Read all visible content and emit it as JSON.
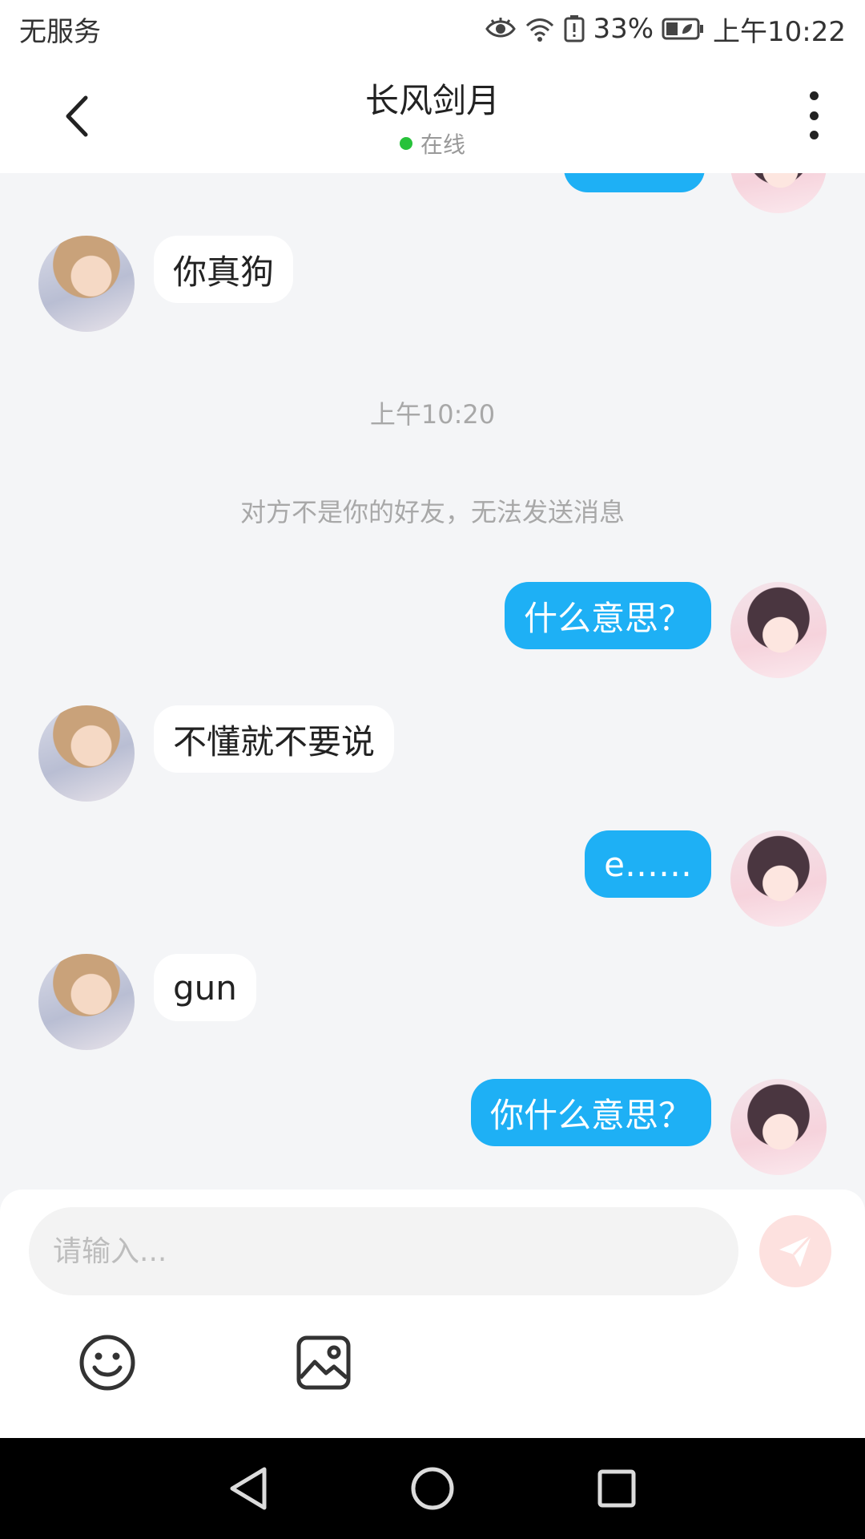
{
  "status_bar": {
    "carrier": "无服务",
    "battery_percent": "33%",
    "time": "上午10:22",
    "icons": [
      "eye-icon",
      "wifi-icon",
      "battery-alert-icon",
      "battery-icon"
    ]
  },
  "header": {
    "title": "长风剑月",
    "status": "在线",
    "status_color": "#27c23a"
  },
  "messages": [
    {
      "side": "left",
      "text": "你真狗"
    },
    {
      "side": "right",
      "text": "什么意思？"
    },
    {
      "side": "left",
      "text": "不懂就不要说"
    },
    {
      "side": "right",
      "text": "e……"
    },
    {
      "side": "left",
      "text": "gun"
    },
    {
      "side": "right",
      "text": "你什么意思？"
    }
  ],
  "timestamp": "上午10:20",
  "system_note": "对方不是你的好友，无法发送消息",
  "input": {
    "placeholder": "请输入...",
    "value": ""
  },
  "colors": {
    "bubble_self": "#1eb0f5",
    "bubble_other": "#ffffff",
    "chat_background": "#f4f5f7",
    "send_button": "#fde1df"
  }
}
